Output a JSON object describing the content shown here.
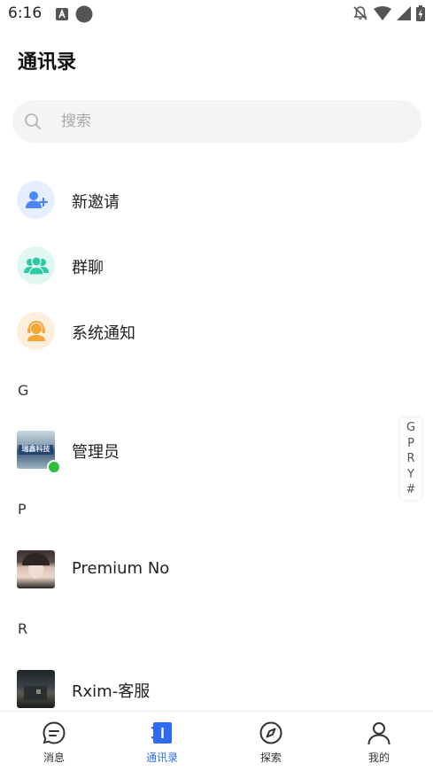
{
  "status_bar": {
    "time": "6:16"
  },
  "page": {
    "title": "通讯录"
  },
  "search": {
    "placeholder": "搜索"
  },
  "quick_actions": [
    {
      "label": "新邀请",
      "icon": "add-user-icon",
      "color": "#4c86f4",
      "bg": "#e6efff"
    },
    {
      "label": "群聊",
      "icon": "group-icon",
      "color": "#2ec9a6",
      "bg": "#e1f8f2"
    },
    {
      "label": "系统通知",
      "icon": "notification-bot-icon",
      "color": "#f7a63a",
      "bg": "#fdefdc"
    }
  ],
  "contacts": {
    "sections": [
      {
        "letter": "G",
        "items": [
          {
            "name": "管理员",
            "avatar_text": "瑞鑫科技",
            "online": true
          }
        ]
      },
      {
        "letter": "P",
        "items": [
          {
            "name": "Premium No"
          }
        ]
      },
      {
        "letter": "R",
        "items": [
          {
            "name": "Rxim-客服"
          }
        ]
      }
    ]
  },
  "index_bar": {
    "letters": [
      "G",
      "P",
      "R",
      "Y",
      "#"
    ]
  },
  "tab_bar": {
    "items": [
      {
        "label": "消息",
        "icon": "message-icon",
        "active": false
      },
      {
        "label": "通讯录",
        "icon": "contacts-icon",
        "active": true
      },
      {
        "label": "探索",
        "icon": "compass-icon",
        "active": false
      },
      {
        "label": "我的",
        "icon": "profile-icon",
        "active": false
      }
    ],
    "active_color": "#2f6bf2"
  }
}
